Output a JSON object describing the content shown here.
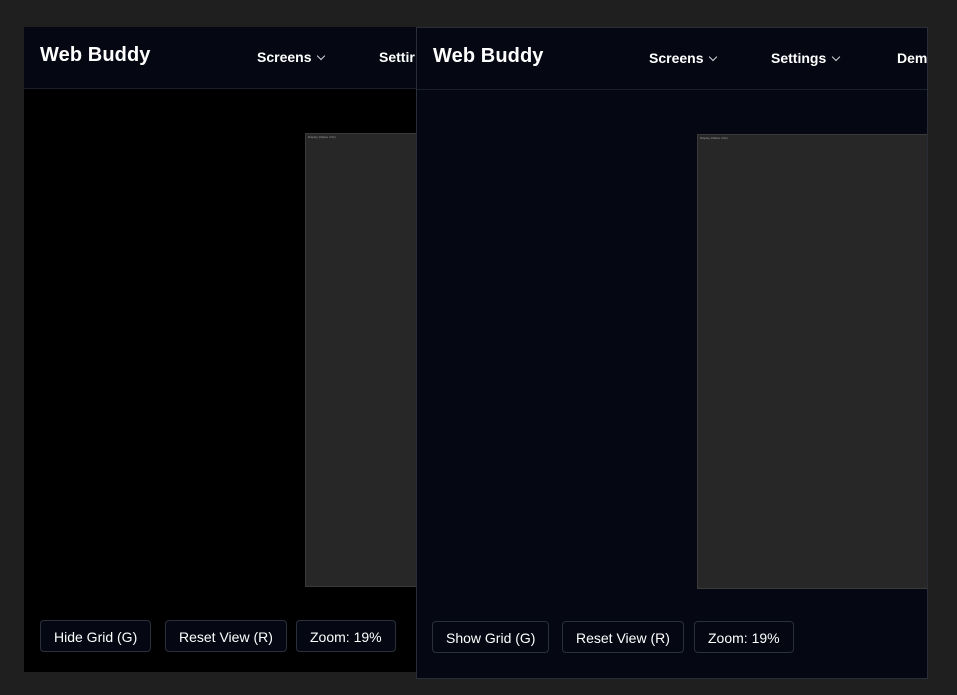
{
  "left_window": {
    "brand": "Web Buddy",
    "nav": {
      "screens_label": "Screens",
      "settings_label": "Settir"
    },
    "screen_label": "Display (Native 4.0s)",
    "toolbar": {
      "grid_label": "Hide Grid (G)",
      "reset_label": "Reset View (R)",
      "zoom_label": "Zoom: 19%"
    }
  },
  "right_window": {
    "brand": "Web Buddy",
    "nav": {
      "screens_label": "Screens",
      "settings_label": "Settings",
      "demo_label": "Dem"
    },
    "screen_label": "Display (Native 4.0s)",
    "toolbar": {
      "grid_label": "Show Grid (G)",
      "reset_label": "Reset View (R)",
      "zoom_label": "Zoom: 19%"
    }
  },
  "icons": {
    "dropdown": "chevron-down-icon"
  },
  "colors": {
    "page_background": "#1f1f1f",
    "navbar_background": "#050812",
    "left_canvas_background": "#000000",
    "right_canvas_background": "#050812",
    "screen_preview": "#272727",
    "text": "#ffffff"
  }
}
